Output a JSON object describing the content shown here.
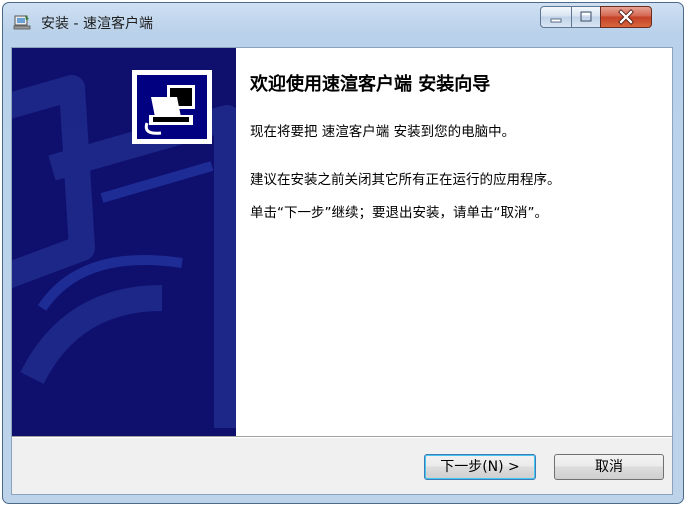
{
  "window": {
    "title": "安装 - 速渲客户端"
  },
  "welcome": {
    "heading": "欢迎使用速渲客户端 安装向导",
    "line1": "现在将要把 速渲客户端 安装到您的电脑中。",
    "line2": "建议在安装之前关闭其它所有正在运行的应用程序。",
    "line3": "单击“下一步”继续；要退出安装，请单击“取消”。"
  },
  "buttons": {
    "next_label": "下一步(N) >",
    "cancel_label": "取消"
  },
  "icons": {
    "app": "installer-app-icon",
    "minimize": "minimize-icon",
    "maximize": "maximize-icon",
    "close": "close-icon",
    "wizard": "installer-computer-icon"
  },
  "colors": {
    "banner": "#0f0f6e",
    "logo_bg": "#000080",
    "close_button": "#c44126"
  }
}
